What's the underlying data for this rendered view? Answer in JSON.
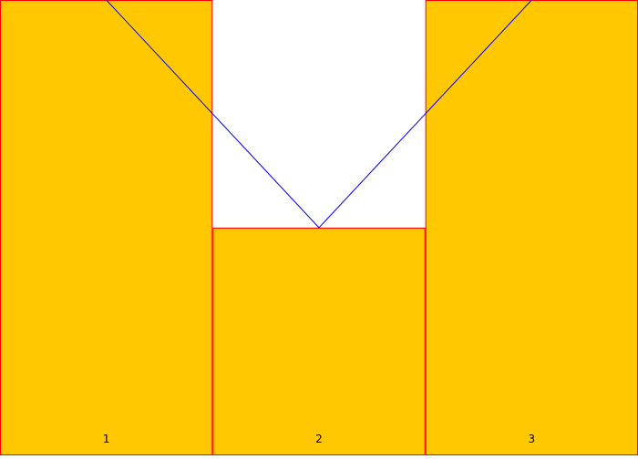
{
  "chart_data": {
    "type": "bar",
    "categories": [
      "1",
      "2",
      "3"
    ],
    "values": [
      2,
      1,
      2
    ],
    "ylim": [
      0,
      2
    ],
    "overlay_line": {
      "type": "line",
      "values": [
        2,
        1,
        2
      ]
    },
    "grid": false,
    "legend": "none",
    "colors": {
      "bar_fill": "#FFC800",
      "bar_stroke": "#FF0000",
      "line": "#0000FF",
      "label": "#000000",
      "background": "#FFFFFF"
    }
  }
}
